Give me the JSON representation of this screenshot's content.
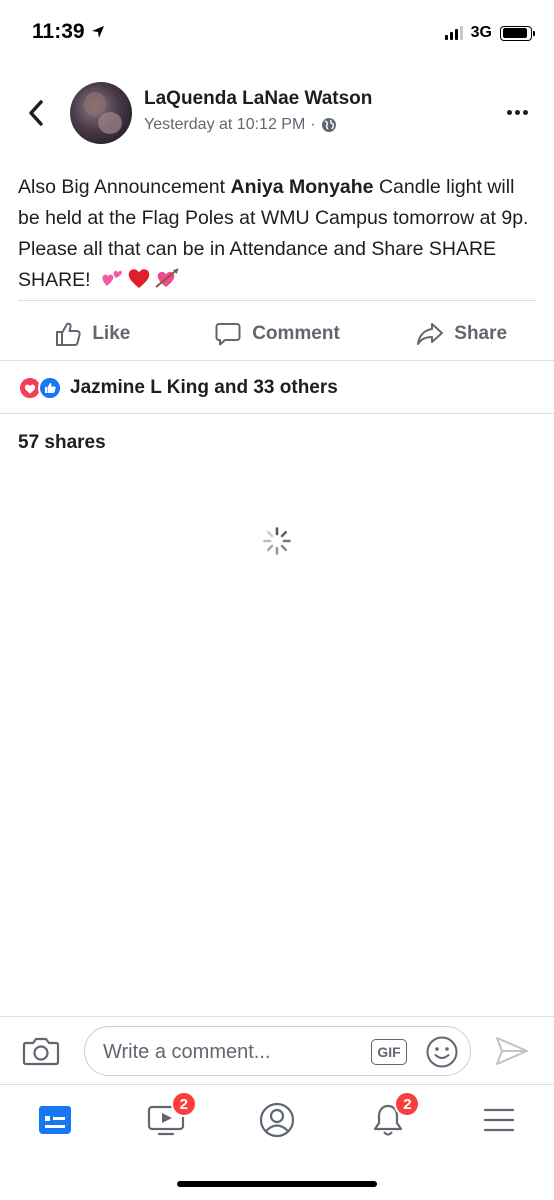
{
  "status_bar": {
    "time": "11:39",
    "network": "3G",
    "signal_bars_active": 3,
    "signal_bars_total": 4,
    "battery_level": 0.9
  },
  "post": {
    "author": "LaQuenda LaNae Watson",
    "timestamp": "Yesterday at 10:12 PM",
    "separator": "·",
    "privacy_icon": "globe-icon",
    "body_prefix": "Also Big Announcement ",
    "body_bold": "Aniya Monyahe",
    "body_suffix": " Candle light will be held at the Flag Poles at WMU Campus tomorrow at 9p. Please all that can be in Attendance and Share SHARE SHARE!",
    "emojis": [
      "💕",
      "❤️",
      "💘"
    ]
  },
  "actions": {
    "like_label": "Like",
    "comment_label": "Comment",
    "share_label": "Share"
  },
  "reactions": {
    "types": [
      "love",
      "like"
    ],
    "summary": "Jazmine L King and 33 others"
  },
  "shares": {
    "label": "57 shares"
  },
  "composer": {
    "placeholder": "Write a comment...",
    "gif_label": "GIF"
  },
  "tab_bar": {
    "tabs": [
      {
        "name": "news-feed",
        "icon": "news-feed-icon",
        "active": true,
        "badge": ""
      },
      {
        "name": "watch",
        "icon": "video-icon",
        "active": false,
        "badge": "2"
      },
      {
        "name": "profile",
        "icon": "profile-icon",
        "active": false,
        "badge": ""
      },
      {
        "name": "notifications",
        "icon": "bell-icon",
        "active": false,
        "badge": "2"
      },
      {
        "name": "menu",
        "icon": "menu-icon",
        "active": false,
        "badge": ""
      }
    ]
  },
  "colors": {
    "brand": "#1877f2",
    "text_primary": "#1c1e21",
    "text_secondary": "#606770",
    "badge": "#fa3e3e",
    "love": "#f33e58"
  }
}
